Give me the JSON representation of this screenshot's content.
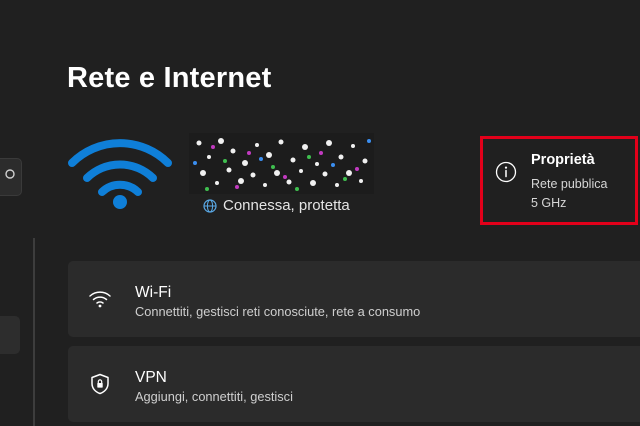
{
  "page": {
    "title": "Rete e Internet"
  },
  "network": {
    "status": "Connessa, protetta",
    "status_icon": "globe-icon",
    "name_obscured": true
  },
  "properties": {
    "title": "Proprietà",
    "network_type": "Rete pubblica",
    "band": "5 GHz",
    "icon": "info-icon",
    "highlight_color": "#e2001a"
  },
  "cards": [
    {
      "title": "Wi-Fi",
      "subtitle": "Connettiti, gestisci reti conosciute, rete a consumo",
      "icon": "wifi-icon"
    },
    {
      "title": "VPN",
      "subtitle": "Aggiungi, connettiti, gestisci",
      "icon": "shield-icon"
    }
  ],
  "colors": {
    "background": "#202020",
    "card": "#2b2b2b",
    "accent": "#0f7fd8"
  }
}
